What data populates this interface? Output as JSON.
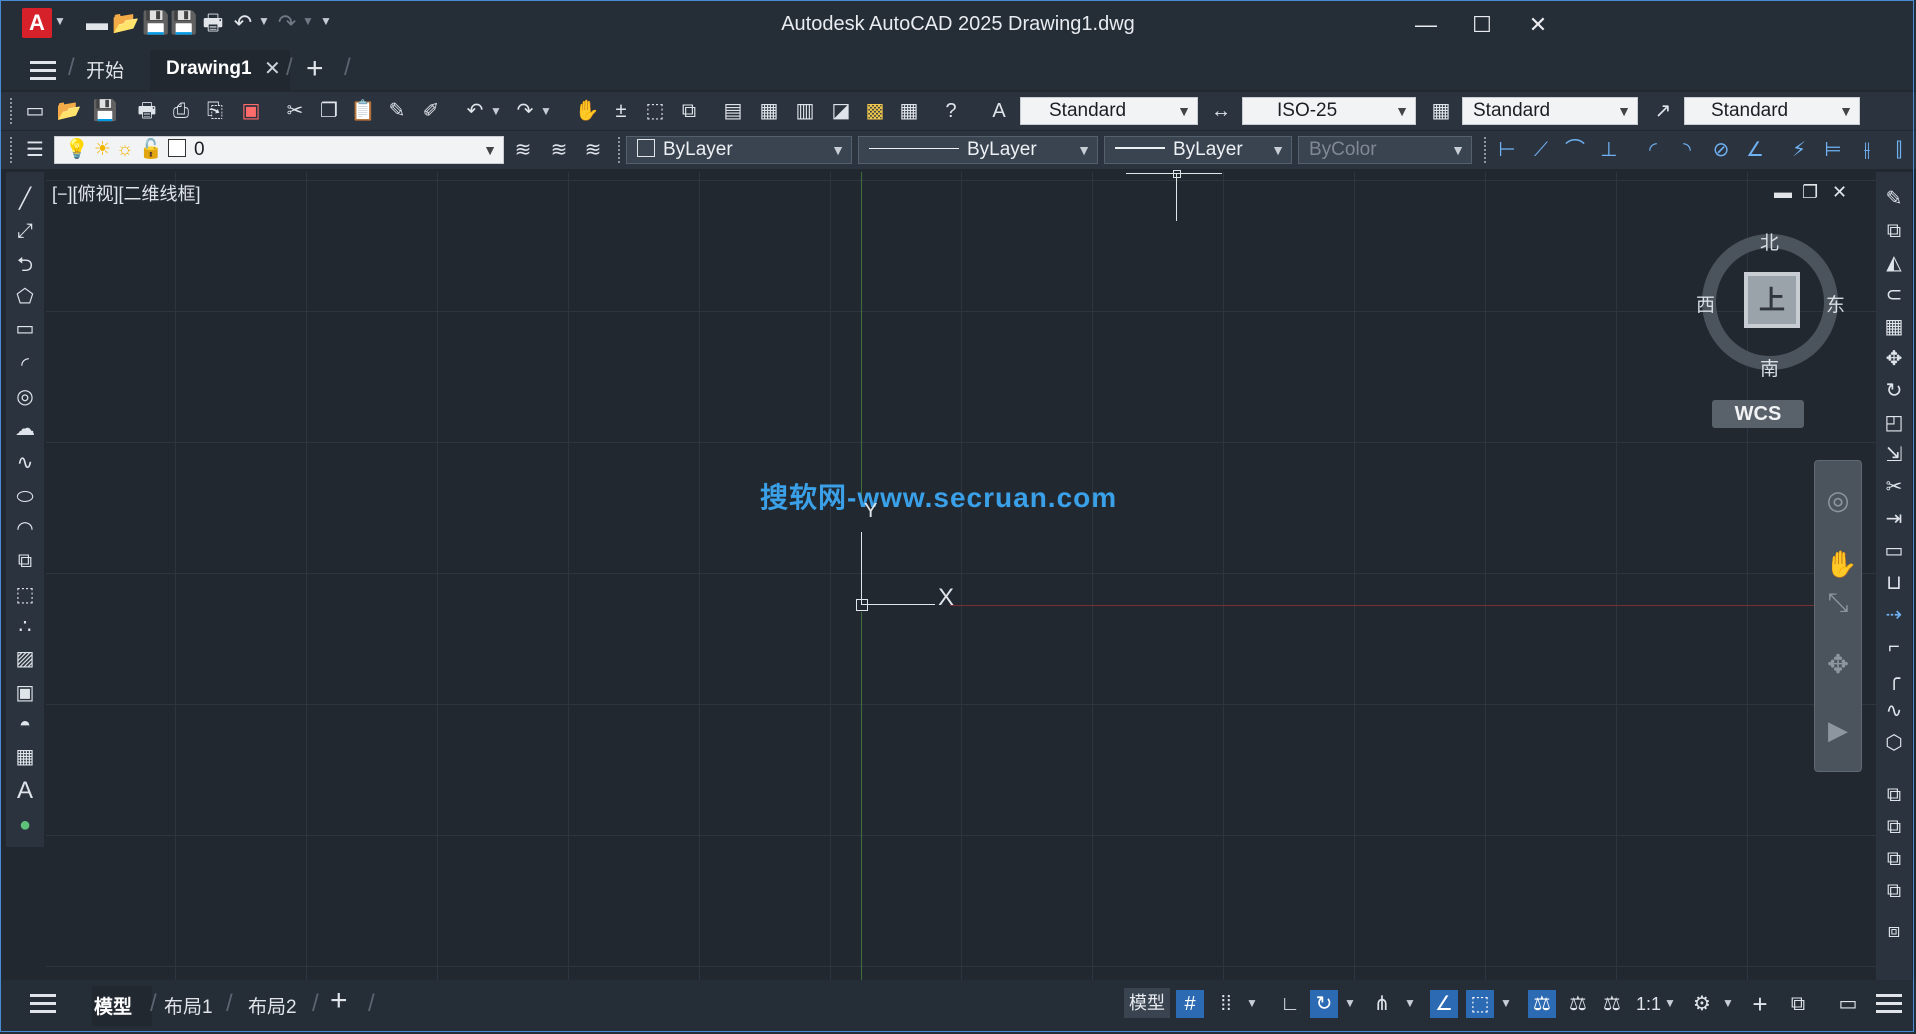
{
  "window": {
    "title": "Autodesk AutoCAD 2025    Drawing1.dwg",
    "app_logo_letter": "A",
    "minimize_glyph": "—",
    "maximize_glyph": "☐",
    "close_glyph": "✕"
  },
  "file_tabs": {
    "start_label": "开始",
    "drawing_label": "Drawing1",
    "close_glyph": "✕",
    "add_glyph": "+"
  },
  "toolbar": {
    "text_style": "Standard",
    "dim_style": "ISO-25",
    "table_style": "Standard",
    "mleader_style": "Standard",
    "layer": "0",
    "color": "ByLayer",
    "linetype": "ByLayer",
    "lineweight": "ByLayer",
    "plotstyle": "ByColor"
  },
  "viewport": {
    "label": "[−][俯视][二维线框]",
    "minimize_glyph": "▬",
    "restore_glyph": "❐",
    "close_glyph": "✕"
  },
  "watermark": "搜软网-www.secruan.com",
  "ucs": {
    "y_label": "Y",
    "x_label": "X"
  },
  "viewcube": {
    "north": "北",
    "south": "南",
    "west": "西",
    "east": "东",
    "face": "上",
    "wcs": "WCS"
  },
  "layout_tabs": {
    "model": "模型",
    "layout1": "布局1",
    "layout2": "布局2",
    "add_glyph": "+"
  },
  "status": {
    "model": "模型",
    "scale": "1:1"
  },
  "colors": {
    "accent": "#2c6bb3",
    "logo": "#d6202a",
    "background": "#212830",
    "watermark": "#3aa0e8"
  }
}
